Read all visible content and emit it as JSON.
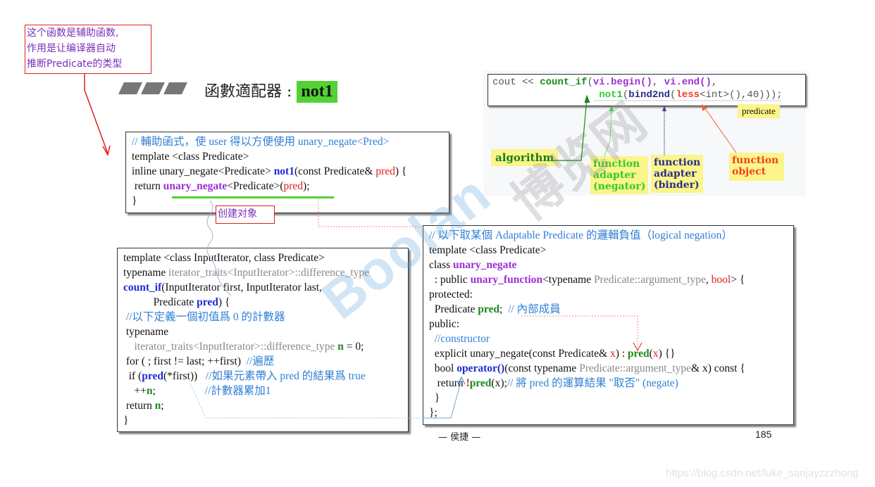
{
  "annotation_note": {
    "lines": [
      "这个函数是辅助函数,",
      "作用是让编译器自动",
      "推断Predicate的类型"
    ]
  },
  "slide_title": {
    "prefix": "函數適配器 :",
    "keyword": "not1"
  },
  "create_object_tag": "创建对象",
  "helper_box": {
    "comment": "// 輔助函式，使 user 得以方便使用 unary_negate<Pred>",
    "line2": "template <class Predicate>",
    "line3_a": "inline unary_negate<Predicate> ",
    "line3_fn": "not1",
    "line3_b": "(const Predicate& ",
    "line3_arg": "pred",
    "line3_c": ") {",
    "line4_a": " return ",
    "line4_cls": "unary_negate",
    "line4_b": "<Predicate>(",
    "line4_arg": "pred",
    "line4_c": ");",
    "line5": "}"
  },
  "count_if_box": {
    "l1": "template <class InputIterator, class Predicate>",
    "l2_a": "typename ",
    "l2_b": "iterator_traits<InputIterator>::difference_type",
    "l3_fn": "count_if",
    "l3_b": "(InputIterator first, InputIterator last,",
    "l4_a": "           Predicate ",
    "l4_arg": "pred",
    "l4_b": ") {",
    "l5": " //以下定義一個初值爲 0 的計數器",
    "l6": " typename",
    "l7_a": "    iterator_traits<InputIterator>::difference_type ",
    "l7_n": "n",
    "l7_b": " = 0;",
    "l8_a": " for ( ; first != last; ++first)  ",
    "l8_c": "//遍歷",
    "l9_a": "  if (",
    "l9_fn": "pred",
    "l9_b": "(*first))   ",
    "l9_c": "//如果元素帶入 pred 的結果爲 true",
    "l10_a": "    ++",
    "l10_n": "n",
    "l10_b": ";                  ",
    "l10_c": "//計數器累加1",
    "l11_a": " return ",
    "l11_n": "n",
    "l11_b": ";",
    "l12": "}"
  },
  "unary_negate_box": {
    "l1": "// 以下取某個 Adaptable Predicate 的邏輯負值（logical negation）",
    "l2": "template <class Predicate>",
    "l3_a": "class ",
    "l3_cls": "unary_negate",
    "l4_a": "  : public ",
    "l4_cls": "unary_function",
    "l4_b": "<typename ",
    "l4_c": "Predicate::argument_type",
    "l4_d": ", ",
    "l4_e": "bool",
    "l4_f": "> {",
    "l5": "protected:",
    "l6_a": "  Predicate ",
    "l6_m": "pred",
    "l6_b": ";  ",
    "l6_c": "// 內部成員",
    "l7": "public:",
    "l8": "  //constructor",
    "l9_a": "  explicit unary_negate(const Predicate& ",
    "l9_x": "x",
    "l9_b": ") : ",
    "l9_m": "pred",
    "l9_c": "(",
    "l9_x2": "x",
    "l9_d": ") {}",
    "l10_a": "  bool ",
    "l10_op": "operator()",
    "l10_b": "(const typename ",
    "l10_c": "Predicate::argument_type",
    "l10_d": "& x) const {",
    "l11_a": "   return ",
    "l11_not": "!",
    "l11_m": "pred",
    "l11_b": "(x);",
    "l11_c": "// 將 pred 的運算結果 \"取否\" (negate)",
    "l12": "  }",
    "l13": "};"
  },
  "usage_diagram": {
    "code_l1_a": "cout << ",
    "code_l1_fn": "count_if",
    "code_l1_b": "(",
    "code_l1_c": "vi.begin()",
    "code_l1_d": ", ",
    "code_l1_e": "vi.end()",
    "code_l1_f": ",",
    "code_l2_pad": "                  ",
    "code_l2_not1": "not1",
    "code_l2_a": "(",
    "code_l2_bind": "bind2nd",
    "code_l2_b": "(",
    "code_l2_less": "less",
    "code_l2_c": "<int>(),40)));",
    "labels": {
      "predicate": "predicate",
      "algorithm": "algorithm",
      "negator": [
        "function",
        "adapter",
        "(negator)"
      ],
      "binder": [
        "function",
        "adapter",
        "(binder)"
      ],
      "function_object": [
        "function",
        "object"
      ]
    }
  },
  "footer": {
    "author": "— 侯捷 —",
    "page_number": "185"
  },
  "watermarks": {
    "site_url": "https://blog.csdn.net/luke_sanjayzzzhong",
    "logo_text": "Boolan",
    "cn_text": "博览网"
  },
  "colors": {
    "title_highlight": "#52d233",
    "annotation_border": "#e02020",
    "annotation_text": "#7a2fb8",
    "comment_blue": "#2f7fd6",
    "tag_yellow": "#fbf58a"
  }
}
